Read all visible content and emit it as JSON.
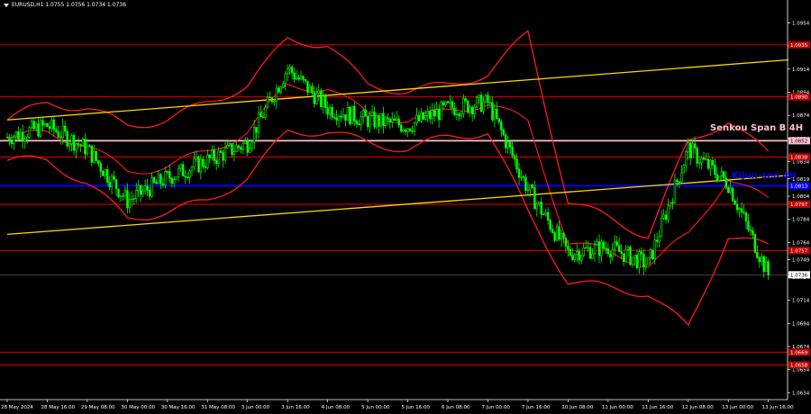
{
  "header": {
    "symbol_line": "EURUSD,H1  1.0755 1.0756 1.0734 1.0736"
  },
  "annotations": {
    "senkou": "Senkou Span B 4H",
    "kijun": "Kijun-sen 4H"
  },
  "price_axis": {
    "ticks": [
      "1.0954",
      "1.0934",
      "1.0914",
      "1.0894",
      "1.0874",
      "1.0854",
      "1.0834",
      "1.0819",
      "1.0804",
      "1.0784",
      "1.0764",
      "1.0749",
      "1.0734",
      "1.0714",
      "1.0694",
      "1.0674",
      "1.0654",
      "1.0634"
    ],
    "current_price": "1.0736",
    "level_labels": [
      {
        "price": "1.0935",
        "kind": "red"
      },
      {
        "price": "1.0890",
        "kind": "red"
      },
      {
        "price": "1.0852",
        "kind": "white"
      },
      {
        "price": "1.0838",
        "kind": "red"
      },
      {
        "price": "1.0813",
        "kind": "blue"
      },
      {
        "price": "1.0797",
        "kind": "red"
      },
      {
        "price": "1.0757",
        "kind": "red"
      },
      {
        "price": "1.0669",
        "kind": "red"
      },
      {
        "price": "1.0658",
        "kind": "red"
      }
    ]
  },
  "time_axis": {
    "ticks": [
      "28 May 2024",
      "28 May 16:00",
      "29 May 08:00",
      "30 May 00:00",
      "30 May 16:00",
      "31 May 08:00",
      "3 Jun 00:00",
      "3 Jun 16:00",
      "4 Jun 08:00",
      "5 Jun 00:00",
      "5 Jun 16:00",
      "6 Jun 08:00",
      "7 Jun 00:00",
      "7 Jun 16:00",
      "10 Jun 08:00",
      "11 Jun 00:00",
      "11 Jun 16:00",
      "12 Jun 08:00",
      "13 Jun 00:00",
      "13 Jun 16:00"
    ]
  },
  "colors": {
    "background": "#000000",
    "candles": "#00ff00",
    "bands": "#ff1a1a",
    "channel": "#ffd700",
    "senkou": "#ffc0cb",
    "kijun": "#0000ff",
    "levels": "#c00000",
    "axis_text": "#ffffff"
  },
  "chart_data": {
    "type": "line",
    "symbol": "EURUSD",
    "timeframe": "H1",
    "ylim": [
      1.0628,
      1.0966
    ],
    "x": [
      "28 May 2024",
      "28 May 16:00",
      "29 May 08:00",
      "30 May 00:00",
      "30 May 16:00",
      "31 May 08:00",
      "3 Jun 00:00",
      "3 Jun 16:00",
      "4 Jun 08:00",
      "5 Jun 00:00",
      "5 Jun 16:00",
      "6 Jun 08:00",
      "7 Jun 00:00",
      "7 Jun 16:00",
      "10 Jun 08:00",
      "11 Jun 00:00",
      "11 Jun 16:00",
      "12 Jun 08:00",
      "13 Jun 00:00",
      "13 Jun 16:00"
    ],
    "price": [
      1.0855,
      1.0865,
      1.0845,
      1.08,
      1.082,
      1.0835,
      1.085,
      1.0915,
      1.088,
      1.087,
      1.0865,
      1.088,
      1.0885,
      1.081,
      1.0755,
      1.076,
      1.0745,
      1.0845,
      1.0815,
      1.0736
    ],
    "upper_band": [
      1.087,
      1.0885,
      1.088,
      1.0865,
      1.087,
      1.0885,
      1.09,
      1.094,
      1.0935,
      1.09,
      1.0895,
      1.09,
      1.091,
      1.0945,
      1.08,
      1.0785,
      1.077,
      1.085,
      1.087,
      1.084
    ],
    "lower_band": [
      1.0835,
      1.0835,
      1.0815,
      1.0785,
      1.079,
      1.08,
      1.082,
      1.086,
      1.086,
      1.085,
      1.0845,
      1.0855,
      1.086,
      1.079,
      1.073,
      1.0725,
      1.072,
      1.069,
      1.077,
      1.076
    ],
    "channel_upper": [
      [
        0,
        1.087
      ],
      [
        19.5,
        1.0922
      ]
    ],
    "channel_lower": [
      [
        0,
        1.0771
      ],
      [
        19.5,
        1.0822
      ]
    ],
    "levels": [
      1.0935,
      1.089,
      1.0838,
      1.0797,
      1.0757,
      1.0669,
      1.0658
    ],
    "senkou_span_b": 1.0852,
    "kijun_sen": 1.0813,
    "current_price": 1.0736
  }
}
